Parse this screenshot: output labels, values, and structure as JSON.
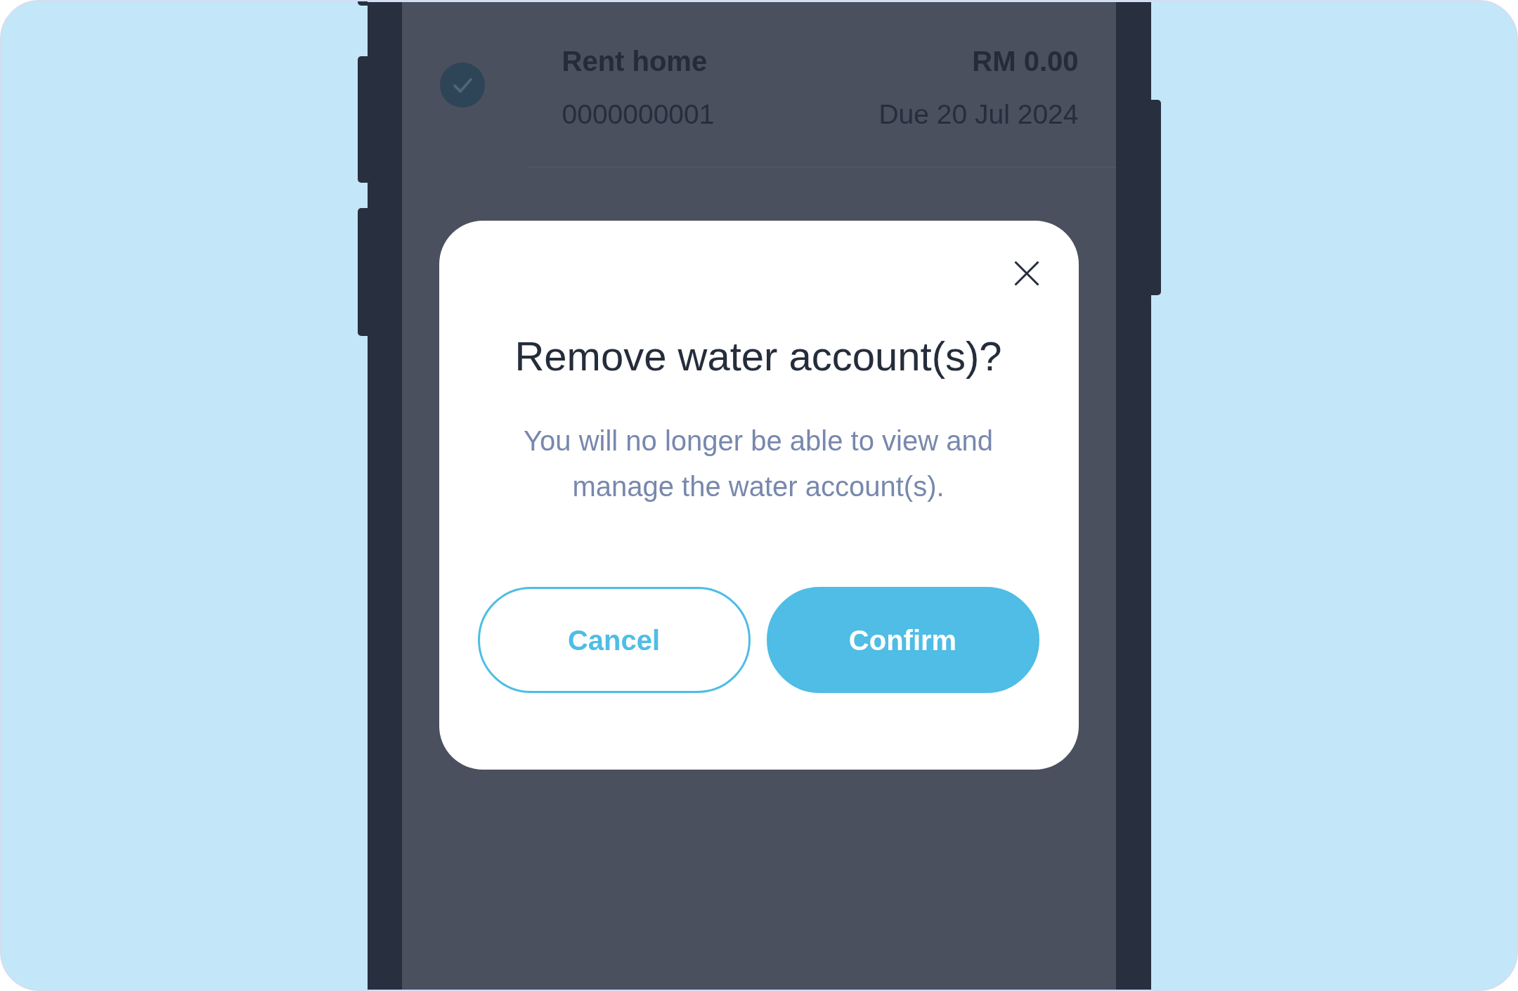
{
  "account_row": {
    "checked": true,
    "name": "Rent home",
    "amount": "RM 0.00",
    "account_number": "0000000001",
    "due": "Due 20 Jul 2024"
  },
  "dialog": {
    "title": "Remove water account(s)?",
    "message": "You will no longer be able to view and manage the water account(s).",
    "buttons": [
      {
        "label": "Cancel",
        "kind": "secondary"
      },
      {
        "label": "Confirm",
        "kind": "primary"
      }
    ]
  }
}
